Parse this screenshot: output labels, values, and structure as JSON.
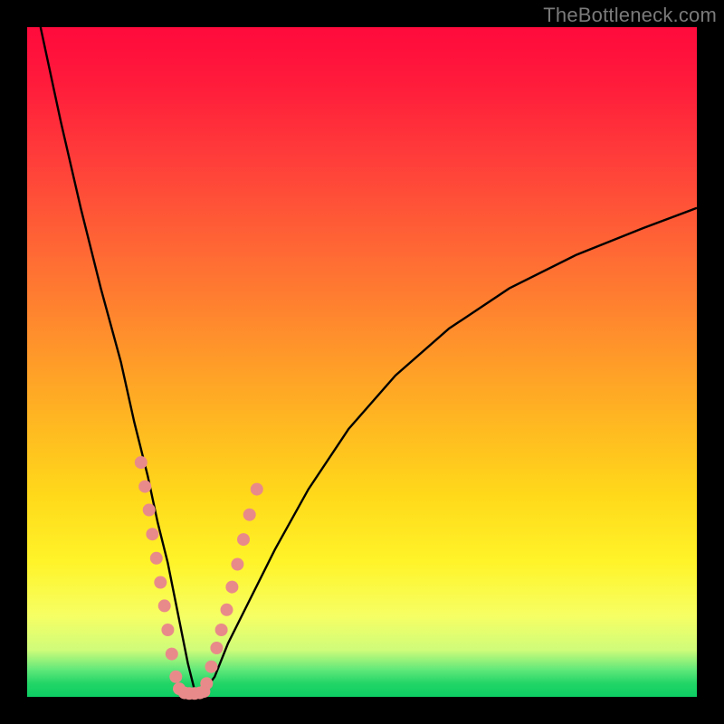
{
  "watermark": "TheBottleneck.com",
  "chart_data": {
    "type": "line",
    "title": "",
    "xlabel": "",
    "ylabel": "",
    "xlim": [
      0,
      100
    ],
    "ylim": [
      0,
      100
    ],
    "curve": {
      "x": [
        2,
        5,
        8,
        11,
        14,
        16,
        18,
        19.5,
        21,
        22,
        23,
        24,
        25,
        26.5,
        28,
        30,
        33,
        37,
        42,
        48,
        55,
        63,
        72,
        82,
        92,
        100
      ],
      "y": [
        100,
        86,
        73,
        61,
        50,
        41,
        33,
        26,
        20,
        15,
        10,
        5,
        1,
        1,
        3,
        8,
        14,
        22,
        31,
        40,
        48,
        55,
        61,
        66,
        70,
        73
      ]
    },
    "scatter_left": {
      "x": [
        17.0,
        17.6,
        18.2,
        18.7,
        19.3,
        19.9,
        20.5,
        21.0,
        21.6,
        22.2,
        22.7
      ],
      "y": [
        35.0,
        31.4,
        27.9,
        24.3,
        20.7,
        17.1,
        13.6,
        10.0,
        6.4,
        3.0,
        1.2
      ]
    },
    "scatter_right": {
      "x": [
        26.8,
        27.5,
        28.3,
        29.0,
        29.8,
        30.6,
        31.4,
        32.3,
        33.2,
        34.3
      ],
      "y": [
        2.0,
        4.5,
        7.3,
        10.0,
        13.0,
        16.4,
        19.8,
        23.5,
        27.2,
        31.0
      ]
    },
    "scatter_bottom": {
      "x": [
        23.5,
        24.2,
        25.0,
        25.8,
        26.4
      ],
      "y": [
        0.6,
        0.5,
        0.5,
        0.6,
        0.8
      ]
    },
    "dot_color": "#e98a8a",
    "curve_color": "#000000"
  }
}
